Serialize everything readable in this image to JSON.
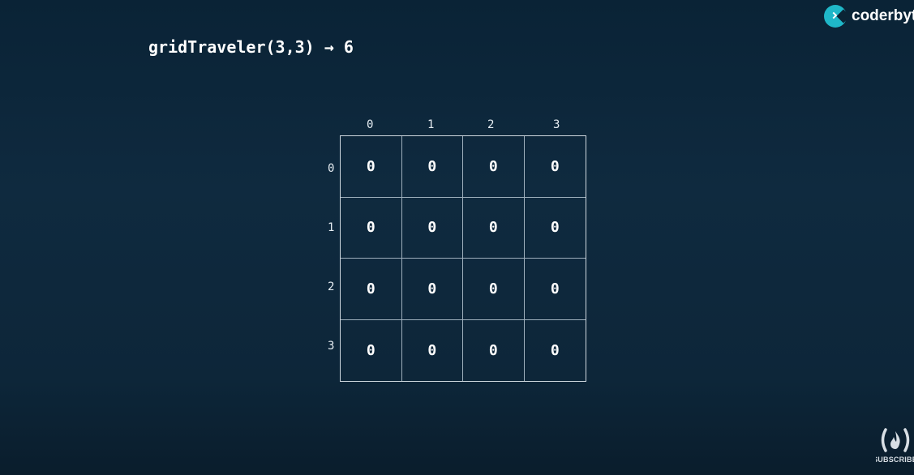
{
  "title": "gridTraveler(3,3) → 6",
  "logo": {
    "text": "coderbyt"
  },
  "grid": {
    "column_labels": [
      "0",
      "1",
      "2",
      "3"
    ],
    "row_labels": [
      "0",
      "1",
      "2",
      "3"
    ],
    "cells": [
      [
        "0",
        "0",
        "0",
        "0"
      ],
      [
        "0",
        "0",
        "0",
        "0"
      ],
      [
        "0",
        "0",
        "0",
        "0"
      ],
      [
        "0",
        "0",
        "0",
        "0"
      ]
    ]
  },
  "subscribe": {
    "label": "SUBSCRIBE",
    "icon": "freecodecamp-fire-icon"
  },
  "colors": {
    "background": "#0f2a3f",
    "logo_accent": "#1fb7c8",
    "grid_line": "#9fb0bd"
  }
}
